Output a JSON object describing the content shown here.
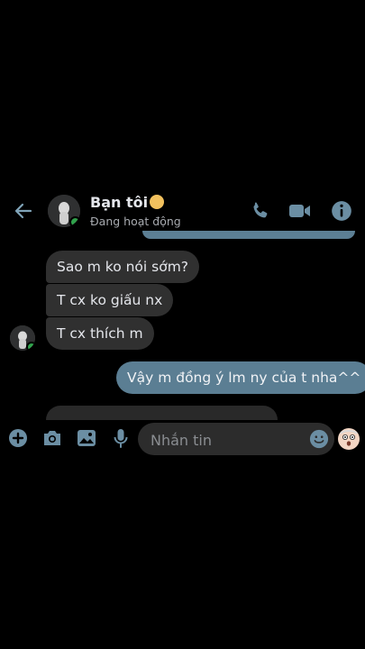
{
  "header": {
    "contact_name": "Bạn tôi",
    "status": "Đang hoạt động",
    "icons": [
      "back-arrow-icon",
      "phone-icon",
      "video-camera-icon",
      "info-icon"
    ]
  },
  "messages": [
    {
      "side": "received",
      "text": "Sao m ko nói sớm?"
    },
    {
      "side": "received",
      "text": "T cx ko giấu nx"
    },
    {
      "side": "received",
      "text": "T cx thích m"
    },
    {
      "side": "sent",
      "text": "Vậy m đồng ý lm ny của t nha^^"
    }
  ],
  "composer": {
    "placeholder": "Nhắn tin",
    "icons": [
      "plus-icon",
      "camera-icon",
      "gallery-icon",
      "microphone-icon",
      "emoji-icon",
      "quick-reaction-icon"
    ]
  },
  "colors": {
    "background": "#000000",
    "received_bubble": "#303030",
    "sent_bubble": "#5b7e93",
    "accent_icon": "#6b8ea3",
    "online": "#31a24c"
  }
}
